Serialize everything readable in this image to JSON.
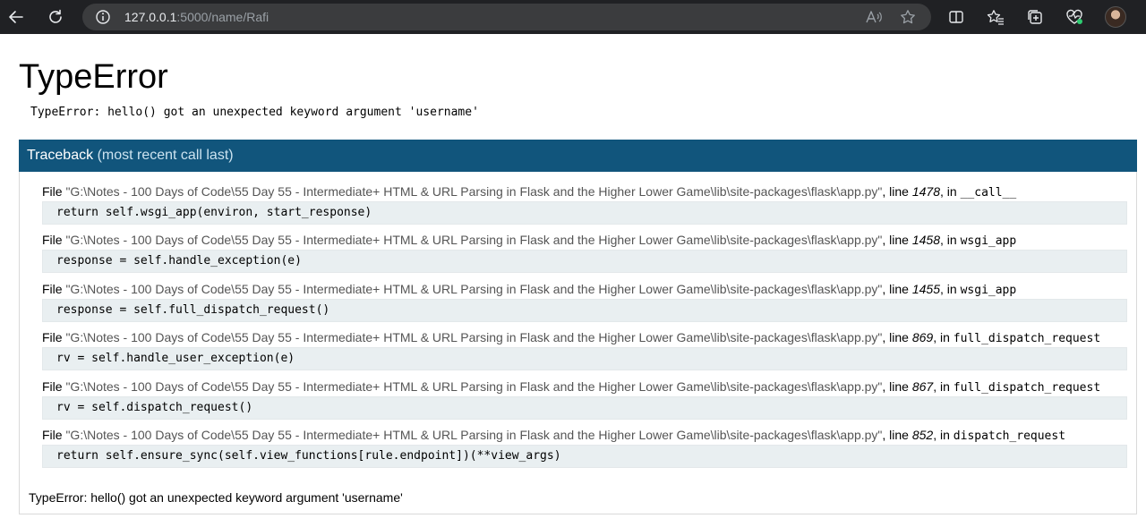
{
  "browser": {
    "url_host": "127.0.0.1",
    "url_rest": ":5000/name/Rafi",
    "icons": [
      "back-icon",
      "refresh-icon",
      "info-icon",
      "read-aloud-icon",
      "favorite-star-icon",
      "split-screen-icon",
      "favorites-icon",
      "collections-icon",
      "browser-essentials-icon",
      "profile-avatar"
    ]
  },
  "error": {
    "title": "TypeError",
    "message": "TypeError: hello() got an unexpected keyword argument 'username'"
  },
  "traceback": {
    "heading": "Traceback",
    "subheading": "(most recent call last)",
    "file_label": "File",
    "line_label": "line",
    "in_label": "in",
    "frames": [
      {
        "file": "\"G:\\Notes - 100 Days of Code\\55 Day 55 - Intermediate+ HTML & URL Parsing in Flask and the Higher Lower Game\\lib\\site-packages\\flask\\app.py\"",
        "line": "1478",
        "function": "__call__",
        "code": "return self.wsgi_app(environ, start_response)"
      },
      {
        "file": "\"G:\\Notes - 100 Days of Code\\55 Day 55 - Intermediate+ HTML & URL Parsing in Flask and the Higher Lower Game\\lib\\site-packages\\flask\\app.py\"",
        "line": "1458",
        "function": "wsgi_app",
        "code": "response = self.handle_exception(e)"
      },
      {
        "file": "\"G:\\Notes - 100 Days of Code\\55 Day 55 - Intermediate+ HTML & URL Parsing in Flask and the Higher Lower Game\\lib\\site-packages\\flask\\app.py\"",
        "line": "1455",
        "function": "wsgi_app",
        "code": "response = self.full_dispatch_request()"
      },
      {
        "file": "\"G:\\Notes - 100 Days of Code\\55 Day 55 - Intermediate+ HTML & URL Parsing in Flask and the Higher Lower Game\\lib\\site-packages\\flask\\app.py\"",
        "line": "869",
        "function": "full_dispatch_request",
        "code": "rv = self.handle_user_exception(e)"
      },
      {
        "file": "\"G:\\Notes - 100 Days of Code\\55 Day 55 - Intermediate+ HTML & URL Parsing in Flask and the Higher Lower Game\\lib\\site-packages\\flask\\app.py\"",
        "line": "867",
        "function": "full_dispatch_request",
        "code": "rv = self.dispatch_request()"
      },
      {
        "file": "\"G:\\Notes - 100 Days of Code\\55 Day 55 - Intermediate+ HTML & URL Parsing in Flask and the Higher Lower Game\\lib\\site-packages\\flask\\app.py\"",
        "line": "852",
        "function": "dispatch_request",
        "code": "return self.ensure_sync(self.view_functions[rule.endpoint])(**view_args)"
      }
    ],
    "final_message": "TypeError: hello() got an unexpected keyword argument 'username'"
  }
}
